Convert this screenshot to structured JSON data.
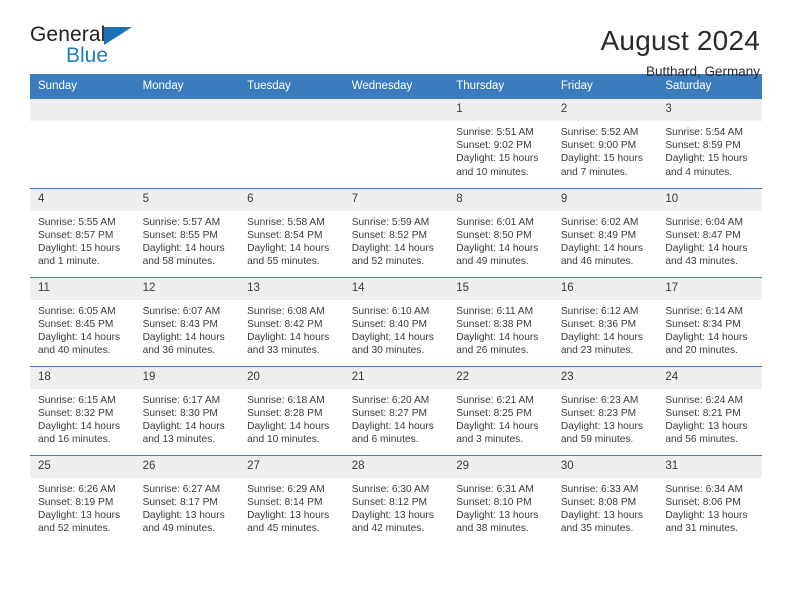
{
  "logo": {
    "line1": "General",
    "line2": "Blue",
    "triangle_icon": "triangle-icon",
    "color_dark": "#231f20",
    "color_blue": "#1f7dc0"
  },
  "header": {
    "title": "August 2024",
    "subtitle": "Butthard, Germany"
  },
  "theme": {
    "header_bg": "#3b7cbf",
    "header_text": "#ffffff",
    "daynum_bg": "#efefef",
    "cell_text": "#3a3a3a",
    "row_rule": "#3b7cbf"
  },
  "weekdays": [
    "Sunday",
    "Monday",
    "Tuesday",
    "Wednesday",
    "Thursday",
    "Friday",
    "Saturday"
  ],
  "weeks": [
    [
      {
        "day": ""
      },
      {
        "day": ""
      },
      {
        "day": ""
      },
      {
        "day": ""
      },
      {
        "day": "1",
        "sunrise": "Sunrise: 5:51 AM",
        "sunset": "Sunset: 9:02 PM",
        "daylight1": "Daylight: 15 hours",
        "daylight2": "and 10 minutes."
      },
      {
        "day": "2",
        "sunrise": "Sunrise: 5:52 AM",
        "sunset": "Sunset: 9:00 PM",
        "daylight1": "Daylight: 15 hours",
        "daylight2": "and 7 minutes."
      },
      {
        "day": "3",
        "sunrise": "Sunrise: 5:54 AM",
        "sunset": "Sunset: 8:59 PM",
        "daylight1": "Daylight: 15 hours",
        "daylight2": "and 4 minutes."
      }
    ],
    [
      {
        "day": "4",
        "sunrise": "Sunrise: 5:55 AM",
        "sunset": "Sunset: 8:57 PM",
        "daylight1": "Daylight: 15 hours",
        "daylight2": "and 1 minute."
      },
      {
        "day": "5",
        "sunrise": "Sunrise: 5:57 AM",
        "sunset": "Sunset: 8:55 PM",
        "daylight1": "Daylight: 14 hours",
        "daylight2": "and 58 minutes."
      },
      {
        "day": "6",
        "sunrise": "Sunrise: 5:58 AM",
        "sunset": "Sunset: 8:54 PM",
        "daylight1": "Daylight: 14 hours",
        "daylight2": "and 55 minutes."
      },
      {
        "day": "7",
        "sunrise": "Sunrise: 5:59 AM",
        "sunset": "Sunset: 8:52 PM",
        "daylight1": "Daylight: 14 hours",
        "daylight2": "and 52 minutes."
      },
      {
        "day": "8",
        "sunrise": "Sunrise: 6:01 AM",
        "sunset": "Sunset: 8:50 PM",
        "daylight1": "Daylight: 14 hours",
        "daylight2": "and 49 minutes."
      },
      {
        "day": "9",
        "sunrise": "Sunrise: 6:02 AM",
        "sunset": "Sunset: 8:49 PM",
        "daylight1": "Daylight: 14 hours",
        "daylight2": "and 46 minutes."
      },
      {
        "day": "10",
        "sunrise": "Sunrise: 6:04 AM",
        "sunset": "Sunset: 8:47 PM",
        "daylight1": "Daylight: 14 hours",
        "daylight2": "and 43 minutes."
      }
    ],
    [
      {
        "day": "11",
        "sunrise": "Sunrise: 6:05 AM",
        "sunset": "Sunset: 8:45 PM",
        "daylight1": "Daylight: 14 hours",
        "daylight2": "and 40 minutes."
      },
      {
        "day": "12",
        "sunrise": "Sunrise: 6:07 AM",
        "sunset": "Sunset: 8:43 PM",
        "daylight1": "Daylight: 14 hours",
        "daylight2": "and 36 minutes."
      },
      {
        "day": "13",
        "sunrise": "Sunrise: 6:08 AM",
        "sunset": "Sunset: 8:42 PM",
        "daylight1": "Daylight: 14 hours",
        "daylight2": "and 33 minutes."
      },
      {
        "day": "14",
        "sunrise": "Sunrise: 6:10 AM",
        "sunset": "Sunset: 8:40 PM",
        "daylight1": "Daylight: 14 hours",
        "daylight2": "and 30 minutes."
      },
      {
        "day": "15",
        "sunrise": "Sunrise: 6:11 AM",
        "sunset": "Sunset: 8:38 PM",
        "daylight1": "Daylight: 14 hours",
        "daylight2": "and 26 minutes."
      },
      {
        "day": "16",
        "sunrise": "Sunrise: 6:12 AM",
        "sunset": "Sunset: 8:36 PM",
        "daylight1": "Daylight: 14 hours",
        "daylight2": "and 23 minutes."
      },
      {
        "day": "17",
        "sunrise": "Sunrise: 6:14 AM",
        "sunset": "Sunset: 8:34 PM",
        "daylight1": "Daylight: 14 hours",
        "daylight2": "and 20 minutes."
      }
    ],
    [
      {
        "day": "18",
        "sunrise": "Sunrise: 6:15 AM",
        "sunset": "Sunset: 8:32 PM",
        "daylight1": "Daylight: 14 hours",
        "daylight2": "and 16 minutes."
      },
      {
        "day": "19",
        "sunrise": "Sunrise: 6:17 AM",
        "sunset": "Sunset: 8:30 PM",
        "daylight1": "Daylight: 14 hours",
        "daylight2": "and 13 minutes."
      },
      {
        "day": "20",
        "sunrise": "Sunrise: 6:18 AM",
        "sunset": "Sunset: 8:28 PM",
        "daylight1": "Daylight: 14 hours",
        "daylight2": "and 10 minutes."
      },
      {
        "day": "21",
        "sunrise": "Sunrise: 6:20 AM",
        "sunset": "Sunset: 8:27 PM",
        "daylight1": "Daylight: 14 hours",
        "daylight2": "and 6 minutes."
      },
      {
        "day": "22",
        "sunrise": "Sunrise: 6:21 AM",
        "sunset": "Sunset: 8:25 PM",
        "daylight1": "Daylight: 14 hours",
        "daylight2": "and 3 minutes."
      },
      {
        "day": "23",
        "sunrise": "Sunrise: 6:23 AM",
        "sunset": "Sunset: 8:23 PM",
        "daylight1": "Daylight: 13 hours",
        "daylight2": "and 59 minutes."
      },
      {
        "day": "24",
        "sunrise": "Sunrise: 6:24 AM",
        "sunset": "Sunset: 8:21 PM",
        "daylight1": "Daylight: 13 hours",
        "daylight2": "and 56 minutes."
      }
    ],
    [
      {
        "day": "25",
        "sunrise": "Sunrise: 6:26 AM",
        "sunset": "Sunset: 8:19 PM",
        "daylight1": "Daylight: 13 hours",
        "daylight2": "and 52 minutes."
      },
      {
        "day": "26",
        "sunrise": "Sunrise: 6:27 AM",
        "sunset": "Sunset: 8:17 PM",
        "daylight1": "Daylight: 13 hours",
        "daylight2": "and 49 minutes."
      },
      {
        "day": "27",
        "sunrise": "Sunrise: 6:29 AM",
        "sunset": "Sunset: 8:14 PM",
        "daylight1": "Daylight: 13 hours",
        "daylight2": "and 45 minutes."
      },
      {
        "day": "28",
        "sunrise": "Sunrise: 6:30 AM",
        "sunset": "Sunset: 8:12 PM",
        "daylight1": "Daylight: 13 hours",
        "daylight2": "and 42 minutes."
      },
      {
        "day": "29",
        "sunrise": "Sunrise: 6:31 AM",
        "sunset": "Sunset: 8:10 PM",
        "daylight1": "Daylight: 13 hours",
        "daylight2": "and 38 minutes."
      },
      {
        "day": "30",
        "sunrise": "Sunrise: 6:33 AM",
        "sunset": "Sunset: 8:08 PM",
        "daylight1": "Daylight: 13 hours",
        "daylight2": "and 35 minutes."
      },
      {
        "day": "31",
        "sunrise": "Sunrise: 6:34 AM",
        "sunset": "Sunset: 8:06 PM",
        "daylight1": "Daylight: 13 hours",
        "daylight2": "and 31 minutes."
      }
    ]
  ]
}
